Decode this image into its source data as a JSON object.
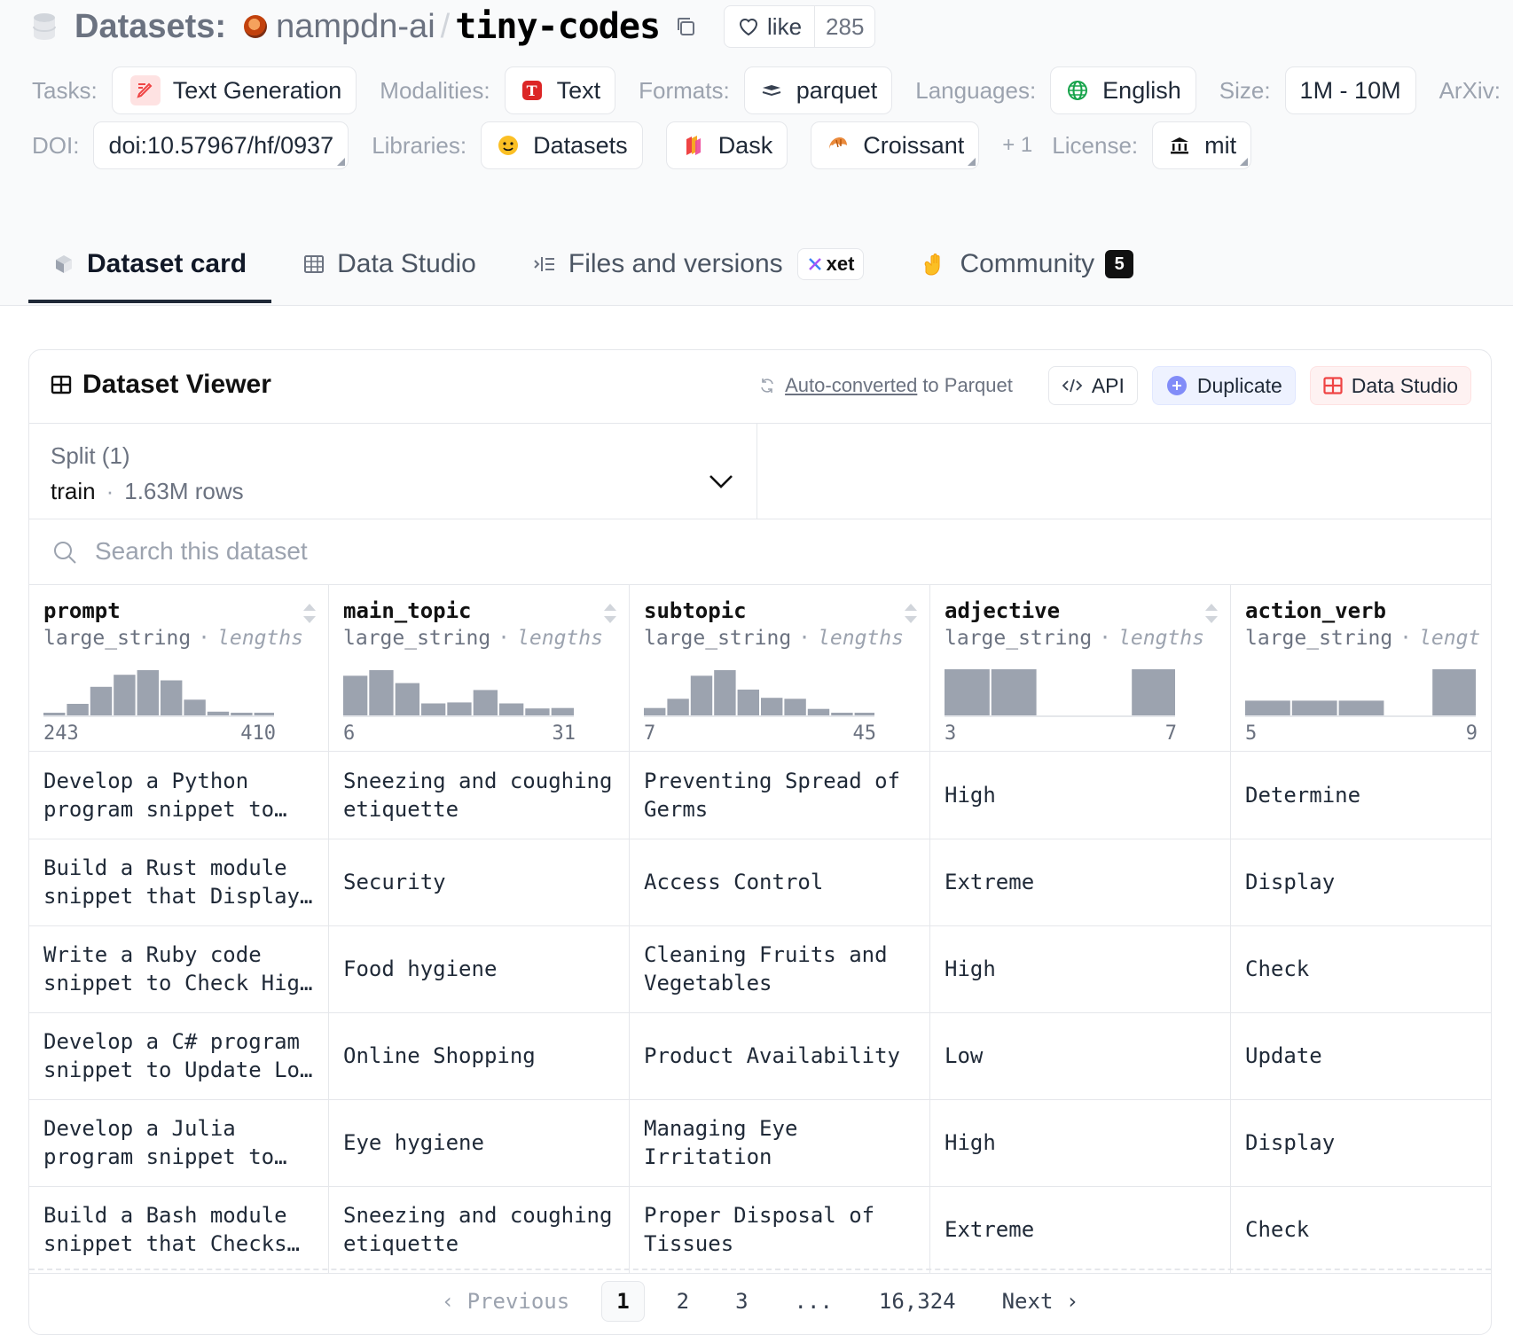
{
  "header": {
    "section_label": "Datasets:",
    "org": "nampdn-ai",
    "separator": "/",
    "name": "tiny-codes",
    "like_label": "like",
    "like_count": "285"
  },
  "tags": {
    "tasks_label": "Tasks:",
    "task": "Text Generation",
    "modalities_label": "Modalities:",
    "modality": "Text",
    "formats_label": "Formats:",
    "format": "parquet",
    "languages_label": "Languages:",
    "language": "English",
    "size_label": "Size:",
    "size": "1M - 10M",
    "arxiv_label": "ArXiv:",
    "doi_label": "DOI:",
    "doi": "doi:10.57967/hf/0937",
    "libraries_label": "Libraries:",
    "libraries": [
      "Datasets",
      "Dask",
      "Croissant"
    ],
    "libraries_more": "+ 1",
    "license_label": "License:",
    "license": "mit"
  },
  "tabs": [
    {
      "label": "Dataset card",
      "active": true
    },
    {
      "label": "Data Studio"
    },
    {
      "label": "Files and versions",
      "badge": "xet"
    },
    {
      "label": "Community",
      "count": "5"
    }
  ],
  "viewer": {
    "title": "Dataset Viewer",
    "auto_converted": "Auto-converted",
    "to_parquet": "to Parquet",
    "api": "API",
    "duplicate": "Duplicate",
    "data_studio": "Data Studio",
    "split_label": "Split (1)",
    "split_name": "train",
    "split_dot": "·",
    "split_rows": "1.63M rows",
    "search_placeholder": "Search this dataset",
    "type_sep": "·",
    "columns": [
      {
        "name": "prompt",
        "type": "large_string",
        "hint": "lengths",
        "min": "243",
        "max": "410",
        "hist": [
          0.04,
          0.25,
          0.62,
          0.88,
          0.98,
          0.76,
          0.34,
          0.08,
          0.03,
          0.02
        ]
      },
      {
        "name": "main_topic",
        "type": "large_string",
        "hint": "lengths",
        "min": "6",
        "max": "31",
        "hist": [
          0.86,
          0.98,
          0.7,
          0.26,
          0.28,
          0.55,
          0.26,
          0.15,
          0.16
        ]
      },
      {
        "name": "subtopic",
        "type": "large_string",
        "hint": "lengths",
        "min": "7",
        "max": "45",
        "hist": [
          0.16,
          0.36,
          0.86,
          0.98,
          0.56,
          0.38,
          0.36,
          0.14,
          0.04,
          0.04
        ]
      },
      {
        "name": "adjective",
        "type": "large_string",
        "hint": "lengths",
        "min": "3",
        "max": "7",
        "hist": [
          1.0,
          1.0,
          0.0,
          0.0,
          1.0
        ]
      },
      {
        "name": "action_verb",
        "type": "large_string",
        "hint": "lengt",
        "min": "5",
        "max": "9",
        "hist": [
          0.32,
          0.32,
          0.32,
          0.0,
          1.0
        ]
      }
    ],
    "rows": [
      [
        "Develop a Python program snippet to…",
        "Sneezing and coughing etiquette",
        "Preventing Spread of Germs",
        "High",
        "Determine"
      ],
      [
        "Build a Rust module snippet that Display…",
        "Security",
        "Access Control",
        "Extreme",
        "Display"
      ],
      [
        "Write a Ruby code snippet to Check Hig…",
        "Food hygiene",
        "Cleaning Fruits and Vegetables",
        "High",
        "Check"
      ],
      [
        "Develop a C# program snippet to Update Lo…",
        "Online Shopping",
        "Product Availability",
        "Low",
        "Update"
      ],
      [
        "Develop a Julia program snippet to…",
        "Eye hygiene",
        "Managing Eye Irritation",
        "High",
        "Display"
      ],
      [
        "Build a Bash module snippet that Checks…",
        "Sneezing and coughing etiquette",
        "Proper Disposal of Tissues",
        "Extreme",
        "Check"
      ]
    ],
    "pagination": {
      "previous": "Previous",
      "pages": [
        "1",
        "2",
        "3",
        "...",
        "16,324"
      ],
      "next": "Next",
      "current": "1"
    }
  },
  "colors": {
    "accent_dark": "#1f2937",
    "histogram_bar": "#9ca3af",
    "muted_text": "#6b7280"
  }
}
